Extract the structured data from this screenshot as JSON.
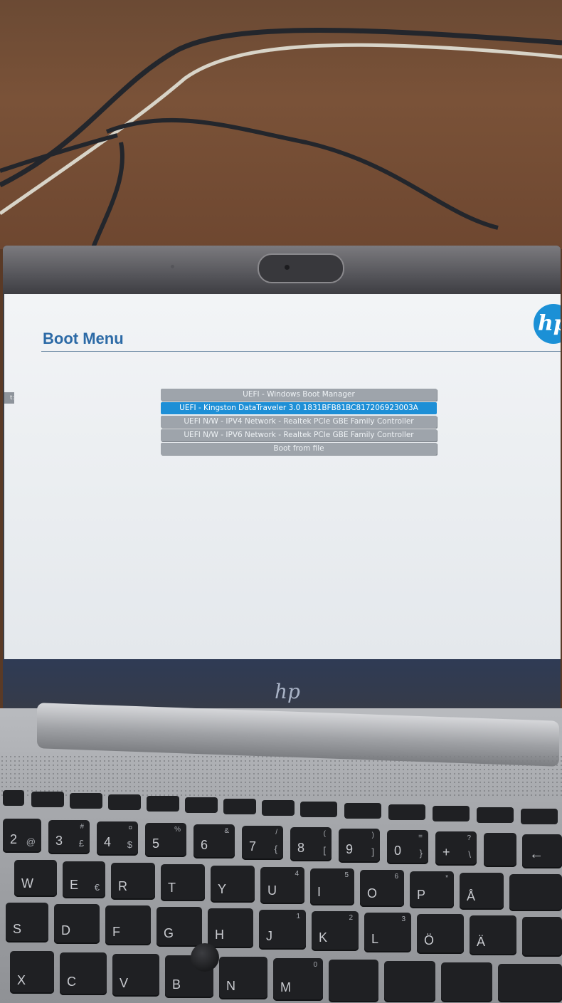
{
  "screen": {
    "title": "Boot Menu",
    "side_tab_text": "t:",
    "boot_items": [
      {
        "label": "UEFI - Windows Boot Manager",
        "selected": false
      },
      {
        "label": "UEFI - Kingston DataTraveler 3.0 1831BFB81BC817206923003A",
        "selected": true
      },
      {
        "label": "UEFI N/W - IPV4 Network - Realtek PCIe GBE Family Controller",
        "selected": false
      },
      {
        "label": "UEFI N/W - IPV6 Network - Realtek PCIe GBE Family Controller",
        "selected": false
      },
      {
        "label": "Boot from file",
        "selected": false
      }
    ],
    "brand_logo_text": "hp",
    "selected_color": "#1e8fd6",
    "item_color": "#9ea4ab",
    "title_color": "#2c6aa6"
  },
  "laptop": {
    "lid_logo_text": "hp"
  },
  "keyboard": {
    "number_row": [
      {
        "main": "2",
        "shift": "@"
      },
      {
        "main": "3",
        "shift": "#",
        "alt": "£"
      },
      {
        "main": "4",
        "shift": "¤",
        "alt": "$"
      },
      {
        "main": "5",
        "shift": "%"
      },
      {
        "main": "6",
        "shift": "&"
      },
      {
        "main": "7",
        "shift": "/",
        "alt": "{"
      },
      {
        "main": "8",
        "shift": "(",
        "alt": "["
      },
      {
        "main": "9",
        "shift": ")",
        "alt": "]"
      },
      {
        "main": "0",
        "shift": "=",
        "alt": "}"
      },
      {
        "main": "+",
        "shift": "?",
        "alt": "\\"
      }
    ],
    "row_q": [
      "W",
      "E",
      "R",
      "T",
      "Y",
      "U",
      "I",
      "O",
      "P",
      "Å"
    ],
    "row_q_sub": [
      "",
      "€",
      "",
      "",
      "",
      "4",
      "5",
      "6",
      "*",
      ""
    ],
    "row_a": [
      "S",
      "D",
      "F",
      "G",
      "H",
      "J",
      "K",
      "L",
      "Ö",
      "Ä"
    ],
    "row_a_sub": [
      "",
      "",
      "",
      "",
      "",
      "1",
      "2",
      "3",
      "",
      ""
    ],
    "row_z": [
      "X",
      "C",
      "V",
      "B",
      "N",
      "M"
    ],
    "row_z_sub": [
      "",
      "",
      "",
      "",
      "",
      "0"
    ]
  }
}
